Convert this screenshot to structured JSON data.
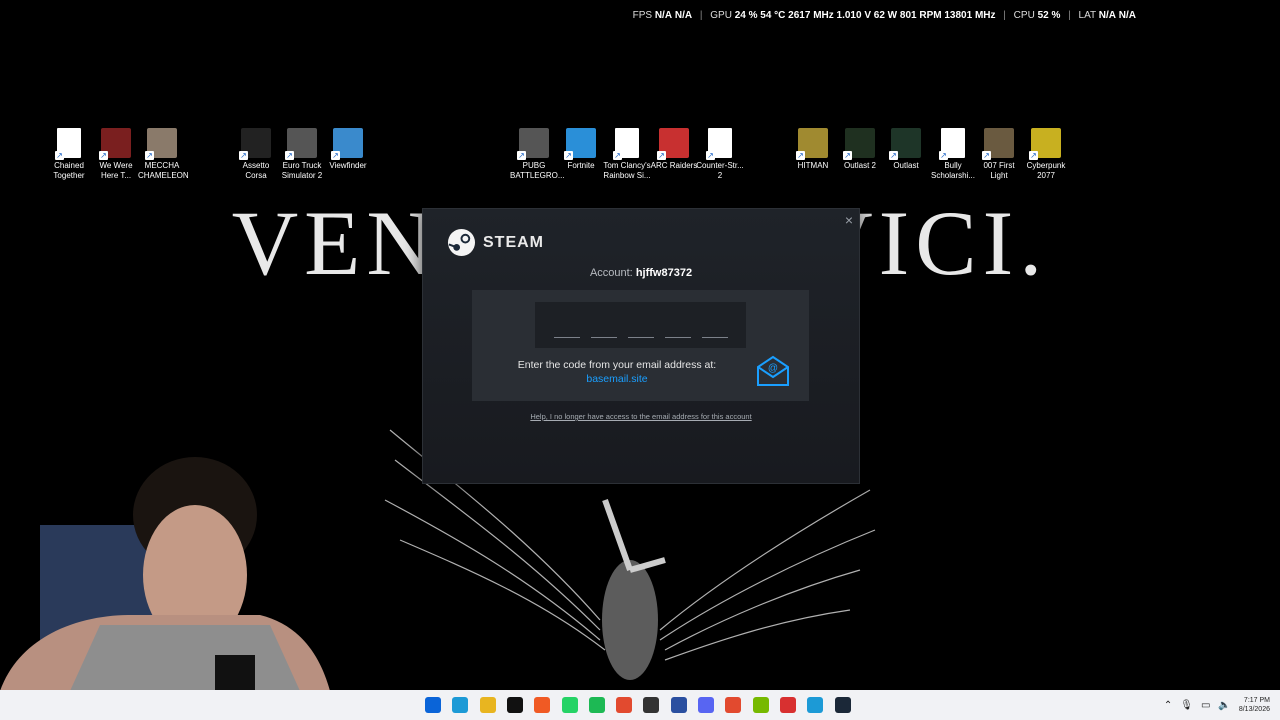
{
  "overlay": {
    "fps_label": "FPS",
    "fps1": "N/A",
    "fps2": "N/A",
    "gpu_label": "GPU",
    "gpu_values": "24 % 54 °C 2617 MHz 1.010 V 62 W 801 RPM 13801 MHz",
    "cpu_label": "CPU",
    "cpu_value": "52 %",
    "lat_label": "LAT",
    "lat1": "N/A",
    "lat2": "N/A"
  },
  "wallpaper": {
    "motto": "VENI, VIDI, VICI."
  },
  "desktop_icons": [
    {
      "label": "Chained Together",
      "icon": "doc-icon"
    },
    {
      "label": "We Were Here T...",
      "icon": "radio-icon"
    },
    {
      "label": "MECCHA CHAMELEON",
      "icon": "game-icon"
    },
    {
      "label": "Assetto Corsa",
      "icon": "ac-icon"
    },
    {
      "label": "Euro Truck Simulator 2",
      "icon": "truck-icon"
    },
    {
      "label": "Viewfinder",
      "icon": "viewfinder-icon"
    },
    {
      "label": "PUBG BATTLEGRO...",
      "icon": "helmet-icon"
    },
    {
      "label": "Fortnite",
      "icon": "fortnite-icon"
    },
    {
      "label": "Tom Clancy's Rainbow Si...",
      "icon": "doc-icon"
    },
    {
      "label": "ARC Raiders",
      "icon": "arc-icon"
    },
    {
      "label": "Counter-Str... 2",
      "icon": "doc-icon"
    },
    {
      "label": "HITMAN",
      "icon": "hitman-icon"
    },
    {
      "label": "Outlast 2",
      "icon": "outlast2-icon"
    },
    {
      "label": "Outlast",
      "icon": "outlast-icon"
    },
    {
      "label": "Bully Scholarshi...",
      "icon": "doc-icon"
    },
    {
      "label": "007 First Light",
      "icon": "007-icon"
    },
    {
      "label": "Cyberpunk 2077",
      "icon": "cyberpunk-icon"
    }
  ],
  "dialog": {
    "brand": "STEAM",
    "account_label": "Account:",
    "account_name": "hjffw87372",
    "prompt": "Enter the code from your email address at:",
    "domain": "basemail.site",
    "help_link": "Help, I no longer have access to the email address for this account",
    "close": "×"
  },
  "taskbar": {
    "apps": [
      "start",
      "edge",
      "files",
      "tiktok",
      "brave",
      "whatsapp",
      "spotify",
      "chrome",
      "app-dark",
      "app-blue",
      "discord",
      "chrome2",
      "nvidia",
      "app-red",
      "edge2",
      "steam"
    ],
    "time": "7:17 PM",
    "date": "8/13/2026"
  },
  "colors": {
    "steam_link": "#1a9fff",
    "dialog_bg": "#1f2329",
    "panel_bg": "#2a2e34"
  }
}
